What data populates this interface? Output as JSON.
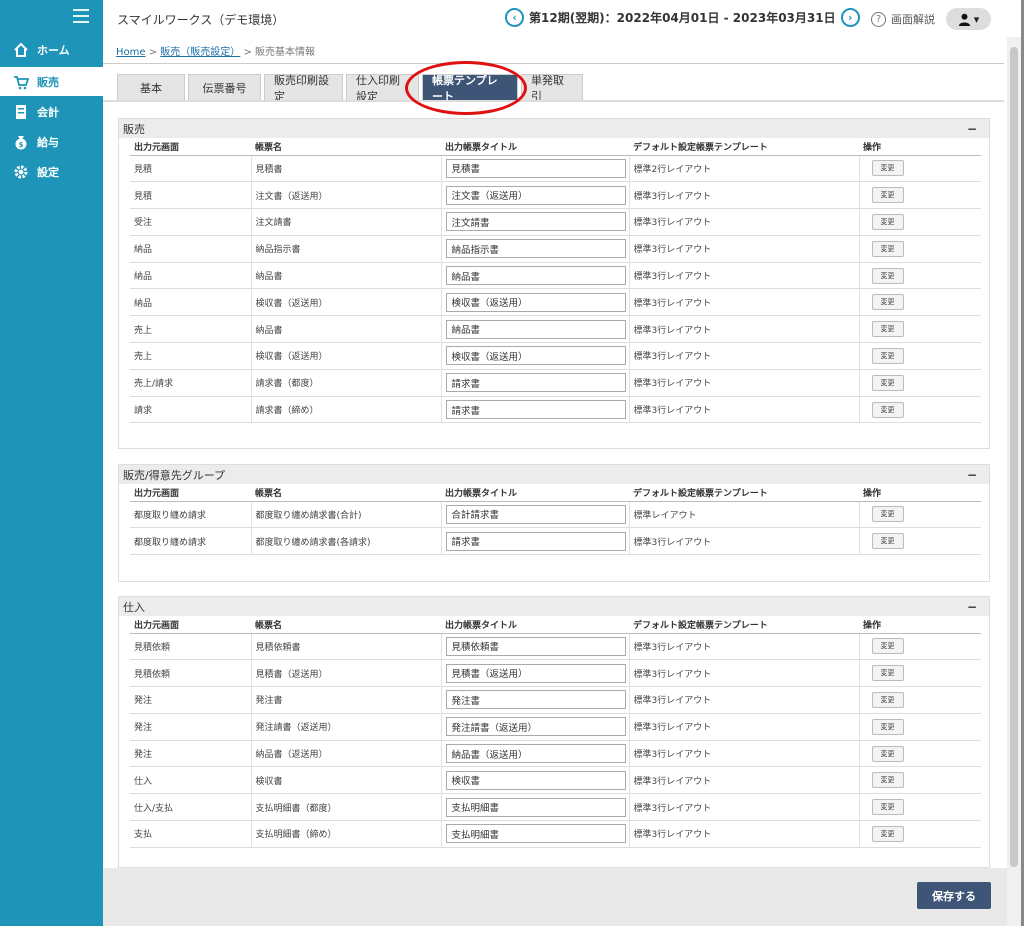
{
  "app": {
    "title": "スマイルワークス（デモ環境）"
  },
  "period": {
    "text": "第12期(翌期)：2022年04月01日 - 2023年03月31日",
    "prev": "‹",
    "next": "›"
  },
  "help": {
    "label": "画面解説",
    "icon": "?"
  },
  "user": {
    "caret": "▾"
  },
  "sidebar": {
    "items": [
      {
        "label": "ホーム",
        "icon": "home-icon"
      },
      {
        "label": "販売",
        "icon": "cart-icon"
      },
      {
        "label": "会計",
        "icon": "ledger-icon"
      },
      {
        "label": "給与",
        "icon": "money-bag-icon"
      },
      {
        "label": "設定",
        "icon": "gear-icon"
      }
    ]
  },
  "breadcrumb": {
    "home": "Home",
    "sep1": " > ",
    "sales": "販売（販売設定）",
    "sep2": " > ",
    "current": "販売基本情報"
  },
  "tabs": [
    {
      "label": "基本"
    },
    {
      "label": "伝票番号"
    },
    {
      "label": "販売印刷設定"
    },
    {
      "label": "仕入印刷設定"
    },
    {
      "label": "帳票テンプレート"
    },
    {
      "label": "単発取引"
    }
  ],
  "columns": {
    "source": "出力元画面",
    "form": "帳票名",
    "title": "出力帳票タイトル",
    "template": "デフォルト設定帳票テンプレート",
    "action": "操作"
  },
  "change_label": "変更",
  "sections": [
    {
      "title": "販売",
      "toggle": "−",
      "rows": [
        {
          "source": "見積",
          "form": "見積書",
          "title": "見積書",
          "template": "標準2行レイアウト"
        },
        {
          "source": "見積",
          "form": "注文書（返送用）",
          "title": "注文書（返送用）",
          "template": "標準3行レイアウト"
        },
        {
          "source": "受注",
          "form": "注文請書",
          "title": "注文請書",
          "template": "標準3行レイアウト"
        },
        {
          "source": "納品",
          "form": "納品指示書",
          "title": "納品指示書",
          "template": "標準3行レイアウト"
        },
        {
          "source": "納品",
          "form": "納品書",
          "title": "納品書",
          "template": "標準3行レイアウト"
        },
        {
          "source": "納品",
          "form": "検収書（返送用）",
          "title": "検収書（返送用）",
          "template": "標準3行レイアウト"
        },
        {
          "source": "売上",
          "form": "納品書",
          "title": "納品書",
          "template": "標準3行レイアウト"
        },
        {
          "source": "売上",
          "form": "検収書（返送用）",
          "title": "検収書（返送用）",
          "template": "標準3行レイアウト"
        },
        {
          "source": "売上/請求",
          "form": "請求書（都度）",
          "title": "請求書",
          "template": "標準3行レイアウト"
        },
        {
          "source": "請求",
          "form": "請求書（締め）",
          "title": "請求書",
          "template": "標準3行レイアウト"
        }
      ]
    },
    {
      "title": "販売/得意先グループ",
      "toggle": "−",
      "rows": [
        {
          "source": "都度取り纏め請求",
          "form": "都度取り纏め請求書(合計)",
          "title": "合計請求書",
          "template": "標準レイアウト"
        },
        {
          "source": "都度取り纏め請求",
          "form": "都度取り纏め請求書(各請求)",
          "title": "請求書",
          "template": "標準3行レイアウト"
        }
      ]
    },
    {
      "title": "仕入",
      "toggle": "−",
      "rows": [
        {
          "source": "見積依頼",
          "form": "見積依頼書",
          "title": "見積依頼書",
          "template": "標準3行レイアウト"
        },
        {
          "source": "見積依頼",
          "form": "見積書（返送用）",
          "title": "見積書（返送用）",
          "template": "標準3行レイアウト"
        },
        {
          "source": "発注",
          "form": "発注書",
          "title": "発注書",
          "template": "標準3行レイアウト"
        },
        {
          "source": "発注",
          "form": "発注請書（返送用）",
          "title": "発注請書（返送用）",
          "template": "標準3行レイアウト"
        },
        {
          "source": "発注",
          "form": "納品書（返送用）",
          "title": "納品書（返送用）",
          "template": "標準3行レイアウト"
        },
        {
          "source": "仕入",
          "form": "検収書",
          "title": "検収書",
          "template": "標準3行レイアウト"
        },
        {
          "source": "仕入/支払",
          "form": "支払明細書（都度）",
          "title": "支払明細書",
          "template": "標準3行レイアウト"
        },
        {
          "source": "支払",
          "form": "支払明細書（締め）",
          "title": "支払明細書",
          "template": "標準3行レイアウト"
        }
      ]
    }
  ],
  "footer": {
    "save_label": "保存する"
  },
  "colors": {
    "sidebar": "#1e95b8",
    "primary": "#3e5577",
    "annotation": "#e01010"
  }
}
